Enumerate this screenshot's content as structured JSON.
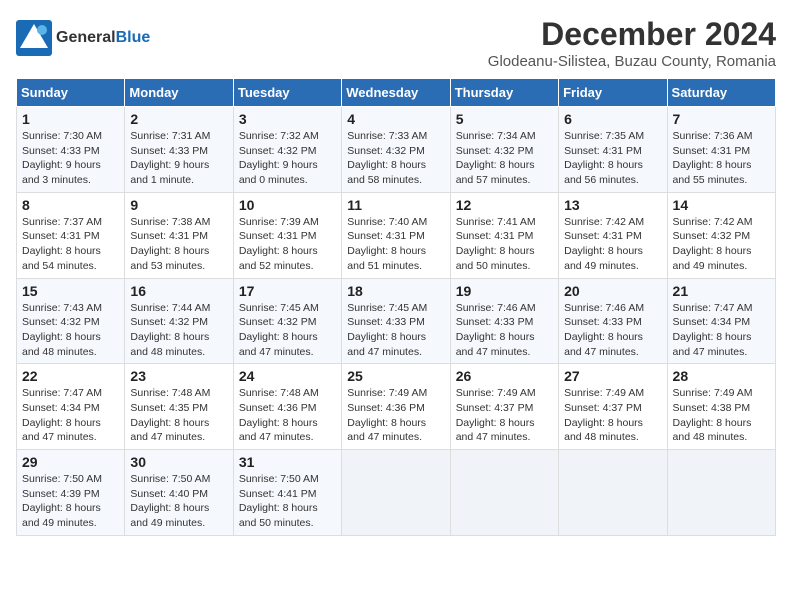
{
  "logo": {
    "general": "General",
    "blue": "Blue"
  },
  "title": "December 2024",
  "location": "Glodeanu-Silistea, Buzau County, Romania",
  "weekdays": [
    "Sunday",
    "Monday",
    "Tuesday",
    "Wednesday",
    "Thursday",
    "Friday",
    "Saturday"
  ],
  "weeks": [
    [
      {
        "day": "1",
        "sunrise": "7:30 AM",
        "sunset": "4:33 PM",
        "daylight": "9 hours and 3 minutes."
      },
      {
        "day": "2",
        "sunrise": "7:31 AM",
        "sunset": "4:33 PM",
        "daylight": "9 hours and 1 minute."
      },
      {
        "day": "3",
        "sunrise": "7:32 AM",
        "sunset": "4:32 PM",
        "daylight": "9 hours and 0 minutes."
      },
      {
        "day": "4",
        "sunrise": "7:33 AM",
        "sunset": "4:32 PM",
        "daylight": "8 hours and 58 minutes."
      },
      {
        "day": "5",
        "sunrise": "7:34 AM",
        "sunset": "4:32 PM",
        "daylight": "8 hours and 57 minutes."
      },
      {
        "day": "6",
        "sunrise": "7:35 AM",
        "sunset": "4:31 PM",
        "daylight": "8 hours and 56 minutes."
      },
      {
        "day": "7",
        "sunrise": "7:36 AM",
        "sunset": "4:31 PM",
        "daylight": "8 hours and 55 minutes."
      }
    ],
    [
      {
        "day": "8",
        "sunrise": "7:37 AM",
        "sunset": "4:31 PM",
        "daylight": "8 hours and 54 minutes."
      },
      {
        "day": "9",
        "sunrise": "7:38 AM",
        "sunset": "4:31 PM",
        "daylight": "8 hours and 53 minutes."
      },
      {
        "day": "10",
        "sunrise": "7:39 AM",
        "sunset": "4:31 PM",
        "daylight": "8 hours and 52 minutes."
      },
      {
        "day": "11",
        "sunrise": "7:40 AM",
        "sunset": "4:31 PM",
        "daylight": "8 hours and 51 minutes."
      },
      {
        "day": "12",
        "sunrise": "7:41 AM",
        "sunset": "4:31 PM",
        "daylight": "8 hours and 50 minutes."
      },
      {
        "day": "13",
        "sunrise": "7:42 AM",
        "sunset": "4:31 PM",
        "daylight": "8 hours and 49 minutes."
      },
      {
        "day": "14",
        "sunrise": "7:42 AM",
        "sunset": "4:32 PM",
        "daylight": "8 hours and 49 minutes."
      }
    ],
    [
      {
        "day": "15",
        "sunrise": "7:43 AM",
        "sunset": "4:32 PM",
        "daylight": "8 hours and 48 minutes."
      },
      {
        "day": "16",
        "sunrise": "7:44 AM",
        "sunset": "4:32 PM",
        "daylight": "8 hours and 48 minutes."
      },
      {
        "day": "17",
        "sunrise": "7:45 AM",
        "sunset": "4:32 PM",
        "daylight": "8 hours and 47 minutes."
      },
      {
        "day": "18",
        "sunrise": "7:45 AM",
        "sunset": "4:33 PM",
        "daylight": "8 hours and 47 minutes."
      },
      {
        "day": "19",
        "sunrise": "7:46 AM",
        "sunset": "4:33 PM",
        "daylight": "8 hours and 47 minutes."
      },
      {
        "day": "20",
        "sunrise": "7:46 AM",
        "sunset": "4:33 PM",
        "daylight": "8 hours and 47 minutes."
      },
      {
        "day": "21",
        "sunrise": "7:47 AM",
        "sunset": "4:34 PM",
        "daylight": "8 hours and 47 minutes."
      }
    ],
    [
      {
        "day": "22",
        "sunrise": "7:47 AM",
        "sunset": "4:34 PM",
        "daylight": "8 hours and 47 minutes."
      },
      {
        "day": "23",
        "sunrise": "7:48 AM",
        "sunset": "4:35 PM",
        "daylight": "8 hours and 47 minutes."
      },
      {
        "day": "24",
        "sunrise": "7:48 AM",
        "sunset": "4:36 PM",
        "daylight": "8 hours and 47 minutes."
      },
      {
        "day": "25",
        "sunrise": "7:49 AM",
        "sunset": "4:36 PM",
        "daylight": "8 hours and 47 minutes."
      },
      {
        "day": "26",
        "sunrise": "7:49 AM",
        "sunset": "4:37 PM",
        "daylight": "8 hours and 47 minutes."
      },
      {
        "day": "27",
        "sunrise": "7:49 AM",
        "sunset": "4:37 PM",
        "daylight": "8 hours and 48 minutes."
      },
      {
        "day": "28",
        "sunrise": "7:49 AM",
        "sunset": "4:38 PM",
        "daylight": "8 hours and 48 minutes."
      }
    ],
    [
      {
        "day": "29",
        "sunrise": "7:50 AM",
        "sunset": "4:39 PM",
        "daylight": "8 hours and 49 minutes."
      },
      {
        "day": "30",
        "sunrise": "7:50 AM",
        "sunset": "4:40 PM",
        "daylight": "8 hours and 49 minutes."
      },
      {
        "day": "31",
        "sunrise": "7:50 AM",
        "sunset": "4:41 PM",
        "daylight": "8 hours and 50 minutes."
      },
      null,
      null,
      null,
      null
    ]
  ]
}
